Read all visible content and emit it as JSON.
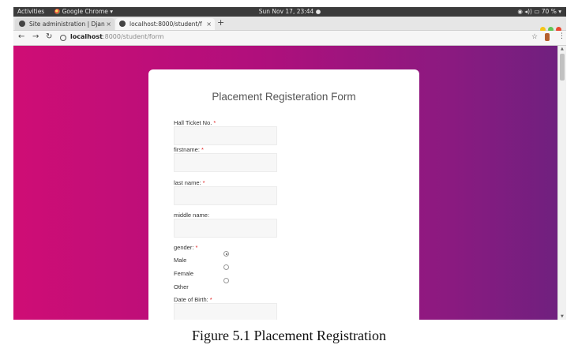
{
  "os_bar": {
    "activities": "Activities",
    "app": "Google Chrome ▾",
    "datetime": "Sun Nov 17, 23:44 ●",
    "battery": "◉ ◂)) ▭ 70 % ▾"
  },
  "tabs": [
    {
      "title": "Site administration | Djan"
    },
    {
      "title": "localhost:8000/student/f"
    }
  ],
  "newtab_label": "+",
  "address": {
    "host": "localhost",
    "path": ":8000/student/form"
  },
  "form": {
    "title": "Placement Registeration Form",
    "fields": [
      {
        "label": "Hall Ticket No.",
        "required": "*"
      },
      {
        "label": "firstname:",
        "required": "*"
      },
      {
        "label": "last name:",
        "required": "*"
      },
      {
        "label": "middle name:",
        "required": ""
      }
    ],
    "gender": {
      "label": "gender:",
      "required": "*",
      "options": [
        "Male",
        "Female",
        "Other"
      ],
      "selected": "Male"
    },
    "dob": {
      "label": "Date of Birth:",
      "required": "*"
    }
  },
  "caption": "Figure 5.1 Placement Registration",
  "colors": {
    "gradient_start": "#cf0d75",
    "gradient_end": "#70207f",
    "required": "#e02020"
  }
}
